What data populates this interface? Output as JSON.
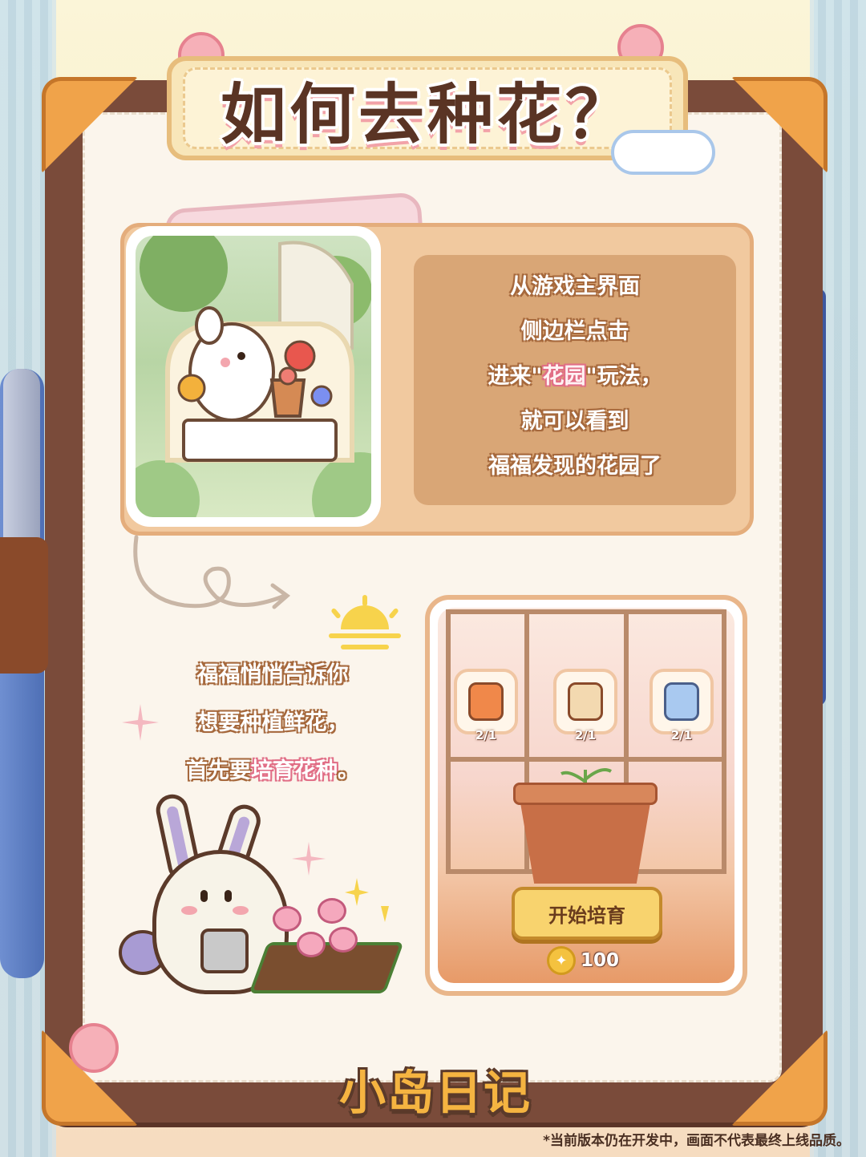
{
  "title": "如何去种花？",
  "step1": {
    "lines": [
      "从游戏主界面",
      "侧边栏点击",
      "进来\"",
      "就可以看到",
      "福福发现的花园了"
    ],
    "line3_prefix": "进来\"",
    "line3_highlight": "花园",
    "line3_suffix": "\"玩法，"
  },
  "step2": {
    "line1": "福福悄悄告诉你",
    "line2": "想要种植鲜花，",
    "line3_prefix": "首先要",
    "line3_highlight": "培育花种",
    "line3_suffix": "。"
  },
  "nursery": {
    "seeds": [
      {
        "icon": "orange-seed-bag-icon",
        "count": "2/1",
        "color": "#f0884a"
      },
      {
        "icon": "seed-bottle-icon",
        "count": "2/1",
        "color": "#f3d9b0"
      },
      {
        "icon": "blue-seed-bag-icon",
        "count": "2/1",
        "color": "#a9c9f0"
      }
    ],
    "start_button": "开始培育",
    "cost": "100"
  },
  "logo": "小岛日记",
  "disclaimer": "*当前版本仍在开发中，画面不代表最终上线品质。",
  "colors": {
    "folder": "#7a4b3a",
    "corner": "#f0a34a",
    "accent_pink": "#e16f87",
    "button": "#f8d36e"
  }
}
